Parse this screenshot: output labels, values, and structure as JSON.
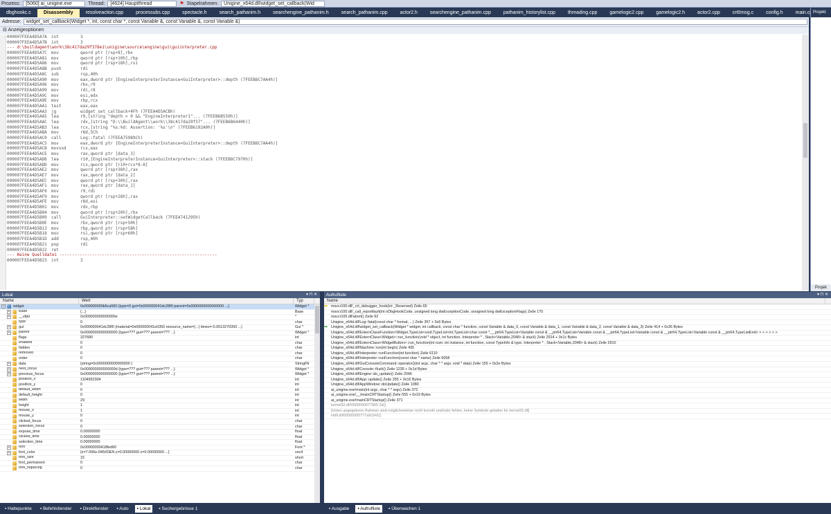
{
  "debug_toolbar": {
    "process_label": "Prozess:",
    "process_value": "[5060] ai_unigine.exe",
    "thread_label": "Thread:",
    "thread_value": "[4624] Hauptthread",
    "stack_label": "Stapelrahmen:",
    "stack_value": "Unigine_x64d.dll!widget_set_callback(Wid"
  },
  "doc_tabs": [
    {
      "label": "dbghookc.c",
      "active": false
    },
    {
      "label": "Disassembly",
      "active": true
    },
    {
      "label": "resolveaction.cpp",
      "active": false
    },
    {
      "label": "processubs.cpp",
      "active": false
    },
    {
      "label": "spectacle.h",
      "active": false
    },
    {
      "label": "search_pathanim.h",
      "active": false
    },
    {
      "label": "searchengine_pathanim.h",
      "active": false
    },
    {
      "label": "search_pathanim.cpp",
      "active": false
    },
    {
      "label": "actor2.h",
      "active": false
    },
    {
      "label": "searchengine_pathanim.cpp",
      "active": false
    },
    {
      "label": "pathanim_historylist.cpp",
      "active": false
    },
    {
      "label": "threading.cpp",
      "active": false
    },
    {
      "label": "gamelogic2.cpp",
      "active": false
    },
    {
      "label": "gamelogic2.h",
      "active": false
    },
    {
      "label": "actor2.cpp",
      "active": false
    },
    {
      "label": "crt0msg.c",
      "active": false
    },
    {
      "label": "config.h",
      "active": false
    },
    {
      "label": "main.cpp",
      "active": false
    }
  ],
  "disassembly": {
    "address_label": "Adresse:",
    "address_value": "widget_set_callback(Widget *, int, const char *, const Variable &, const Variable &, const Variable &)",
    "view_options": "Anzeigeoptionen",
    "lines": [
      {
        "addr": "000007FEEA4D5A7A",
        "mn": "int",
        "op": "3",
        "kind": "code"
      },
      {
        "addr": "000007FEEA4D5A7B",
        "mn": "int",
        "op": "3",
        "kind": "code"
      },
      {
        "text": "--- d:\\buildagent\\work\\38c417da29f378e1\\unigine\\source\\engine\\gui\\guiinterpreter.cpp",
        "kind": "sep"
      },
      {
        "addr": "000007FEEA4D5A7C",
        "mn": "mov",
        "op": "qword ptr [rsp+8],rbx",
        "kind": "code"
      },
      {
        "addr": "000007FEEA4D5A81",
        "mn": "mov",
        "op": "qword ptr [rsp+10h],rbp",
        "kind": "code"
      },
      {
        "addr": "000007FEEA4D5A86",
        "mn": "mov",
        "op": "qword ptr [rsp+18h],rsi",
        "kind": "code"
      },
      {
        "addr": "000007FEEA4D5A8B",
        "mn": "push",
        "op": "rdi",
        "kind": "code"
      },
      {
        "addr": "000007FEEA4D5A8C",
        "mn": "sub",
        "op": "rsp,40h",
        "kind": "code"
      },
      {
        "addr": "000007FEEA4D5A90",
        "mn": "mov",
        "op": "eax,dword ptr [EngineInterpreterInstance<GuiInterpreter>::depth (7FEEB8C7AA4h)]",
        "kind": "code"
      },
      {
        "addr": "000007FEEA4D5A96",
        "mn": "mov",
        "op": "rbx,r9",
        "kind": "code"
      },
      {
        "addr": "000007FEEA4D5A99",
        "mn": "mov",
        "op": "rdi,r8",
        "kind": "code"
      },
      {
        "addr": "000007FEEA4D5A9C",
        "mn": "mov",
        "op": "esi,edx",
        "kind": "code"
      },
      {
        "addr": "000007FEEA4D5A9E",
        "mn": "mov",
        "op": "rbp,rcx",
        "kind": "code"
      },
      {
        "addr": "000007FEEA4D5AA1",
        "mn": "test",
        "op": "eax,eax",
        "kind": "code"
      },
      {
        "addr": "000007FEEA4D5AA3",
        "mn": "jg",
        "op": "widget_set_callback+4Fh (7FEEA4D5ACBh)",
        "kind": "code"
      },
      {
        "addr": "000007FEEA4D5AA5",
        "mn": "lea",
        "op": "r9,[string \"depth > 0 && \"EngineInterpreter1\"... (7FEEB6B550h)]",
        "kind": "code"
      },
      {
        "addr": "000007FEEA4D5AAC",
        "mn": "lea",
        "op": "rdx,[string \"D:\\\\BuildAgent\\\\work\\\\38c417da29f37\"... (7FEEB6B6440h)]",
        "kind": "code"
      },
      {
        "addr": "000007FEEA4D5AB3",
        "mn": "lea",
        "op": "rcx,[string \"%s:%d: Assertion: '%s'\\n\" (7FEEB6192A0h)]",
        "kind": "code"
      },
      {
        "addr": "000007FEEA4D5ABA",
        "mn": "mov",
        "op": "r8d,5Ch",
        "kind": "code"
      },
      {
        "addr": "000007FEEA4D5AC0",
        "mn": "call",
        "op": "Log::fatal (7FEEA75989Ch)",
        "kind": "code"
      },
      {
        "addr": "000007FEEA4D5AC5",
        "mn": "mov",
        "op": "eax,dword ptr [EngineInterpreterInstance<GuiInterpreter>::depth (7FEEB8C7AA4h)]",
        "kind": "cur"
      },
      {
        "addr": "000007FEEA4D5ACB",
        "mn": "movsxd",
        "op": "rcx,eax",
        "kind": "code"
      },
      {
        "addr": "000007FEEA4D5ACE",
        "mn": "mov",
        "op": "rax,qword ptr [data_3]",
        "kind": "code"
      },
      {
        "addr": "000007FEEA4D5AD6",
        "mn": "lea",
        "op": "r10,[EngineInterpreterInstance<GuiInterpreter>::stack (7FEEB8C7970h)]",
        "kind": "code"
      },
      {
        "addr": "000007FEEA4D5ADD",
        "mn": "mov",
        "op": "rcx,qword ptr [r10+rcx*8-8]",
        "kind": "code"
      },
      {
        "addr": "000007FEEA4D5AE2",
        "mn": "mov",
        "op": "qword ptr [rsp+38h],rax",
        "kind": "code"
      },
      {
        "addr": "000007FEEA4D5AE7",
        "mn": "mov",
        "op": "rax,qword ptr [data_2]",
        "kind": "code"
      },
      {
        "addr": "000007FEEA4D5AEC",
        "mn": "mov",
        "op": "qword ptr [rsp+30h],rax",
        "kind": "code"
      },
      {
        "addr": "000007FEEA4D5AF1",
        "mn": "mov",
        "op": "rax,qword ptr [data_1]",
        "kind": "code"
      },
      {
        "addr": "000007FEEA4D5AF6",
        "mn": "mov",
        "op": "r9,rdi",
        "kind": "code"
      },
      {
        "addr": "000007FEEA4D5AF9",
        "mn": "mov",
        "op": "qword ptr [rsp+28h],rax",
        "kind": "code"
      },
      {
        "addr": "000007FEEA4D5AFE",
        "mn": "mov",
        "op": "r8d,esi",
        "kind": "code"
      },
      {
        "addr": "000007FEEA4D5B01",
        "mn": "mov",
        "op": "rdx,rbp",
        "kind": "code"
      },
      {
        "addr": "000007FEEA4D5B04",
        "mn": "mov",
        "op": "qword ptr [rsp+20h],rbx",
        "kind": "code"
      },
      {
        "addr": "000007FEEA4D5B09",
        "mn": "call",
        "op": "GuiInterpreter::setWidgetCallback (7FEEA741295h)",
        "kind": "code"
      },
      {
        "addr": "000007FEEA4D5B0E",
        "mn": "mov",
        "op": "rbx,qword ptr [rsp+50h]",
        "kind": "code"
      },
      {
        "addr": "000007FEEA4D5B13",
        "mn": "mov",
        "op": "rbp,qword ptr [rsp+58h]",
        "kind": "code"
      },
      {
        "addr": "000007FEEA4D5B18",
        "mn": "mov",
        "op": "rsi,qword ptr [rsp+60h]",
        "kind": "code"
      },
      {
        "addr": "000007FEEA4D5B1D",
        "mn": "add",
        "op": "rsp,40h",
        "kind": "code"
      },
      {
        "addr": "000007FEEA4D5B21",
        "mn": "pop",
        "op": "rdi",
        "kind": "code"
      },
      {
        "addr": "000007FEEA4D5B22",
        "mn": "ret",
        "op": "",
        "kind": "code"
      },
      {
        "text": "--- Keine Quelldatei ---------------------------------------------------------------",
        "kind": "sep"
      },
      {
        "addr": "000007FEEA4D5B23",
        "mn": "int",
        "op": "3",
        "kind": "code"
      }
    ]
  },
  "solution_explorer": {
    "title": "Projekt",
    "bottom": "Projek"
  },
  "locals": {
    "title": "Lokal",
    "columns": [
      "Name",
      "Wert",
      "Typ"
    ],
    "rows": [
      {
        "name": "widget",
        "value": "0x000000000b6ca560 {type=0 gui=0x000000041dc28f0 parent=0x0000000000000000 ...}",
        "type": "Widget *",
        "exp": "-",
        "indent": 0,
        "sel": true
      },
      {
        "name": "Base",
        "value": "{...}",
        "type": "Base",
        "exp": "+",
        "indent": 1
      },
      {
        "name": "__vfptr",
        "value": "0x000000000000000e",
        "type": "*",
        "exp": "+",
        "indent": 1
      },
      {
        "name": "type",
        "value": "0",
        "type": "char",
        "exp": "",
        "indent": 1
      },
      {
        "name": "gui",
        "value": "0x000000041dc28f0 {material=0x000000041e0350 resource_name={...} times=-0.0013270393 ...}",
        "type": "Gui *",
        "exp": "+",
        "indent": 1
      },
      {
        "name": "parent",
        "value": "0x0000000000000000 {type=??? gui=??? parent=??? ...}",
        "type": "Widget *",
        "exp": "+",
        "indent": 1
      },
      {
        "name": "flags",
        "value": "327680",
        "type": "int",
        "exp": "",
        "indent": 1
      },
      {
        "name": "enabled",
        "value": "0",
        "type": "char",
        "exp": "",
        "indent": 1
      },
      {
        "name": "hidden",
        "value": "0",
        "type": "char",
        "exp": "",
        "indent": 1
      },
      {
        "name": "removed",
        "value": "0",
        "type": "char",
        "exp": "",
        "indent": 1
      },
      {
        "name": "order",
        "value": "0",
        "type": "char",
        "exp": "",
        "indent": 1
      },
      {
        "name": "data",
        "value": "{string=0x0000000000000000 }",
        "type": "StringPtr",
        "exp": "+",
        "indent": 1
      },
      {
        "name": "next_focus",
        "value": "0x000000000000000d {type=??? gui=??? parent=??? ...}",
        "type": "Widget *",
        "exp": "+",
        "indent": 1
      },
      {
        "name": "previous_focus",
        "value": "0x0000000000000000 {type=??? gui=??? parent=??? ...}",
        "type": "Widget *",
        "exp": "+",
        "indent": 1
      },
      {
        "name": "position_x",
        "value": "1104952304",
        "type": "int",
        "exp": "",
        "indent": 1
      },
      {
        "name": "position_y",
        "value": "0",
        "type": "int",
        "exp": "",
        "indent": 1
      },
      {
        "name": "default_width",
        "value": "0",
        "type": "int",
        "exp": "",
        "indent": 1
      },
      {
        "name": "default_height",
        "value": "0",
        "type": "int",
        "exp": "",
        "indent": 1
      },
      {
        "name": "width",
        "value": "29",
        "type": "int",
        "exp": "",
        "indent": 1
      },
      {
        "name": "height",
        "value": "1",
        "type": "int",
        "exp": "",
        "indent": 1
      },
      {
        "name": "mouse_x",
        "value": "1",
        "type": "int",
        "exp": "",
        "indent": 1
      },
      {
        "name": "mouse_y",
        "value": "0",
        "type": "int",
        "exp": "",
        "indent": 1
      },
      {
        "name": "clicked_focus",
        "value": "0",
        "type": "char",
        "exp": "",
        "indent": 1
      },
      {
        "name": "selection_focus",
        "value": "0",
        "type": "char",
        "exp": "",
        "indent": 1
      },
      {
        "name": "expose_time",
        "value": "0.00000000",
        "type": "float",
        "exp": "",
        "indent": 1
      },
      {
        "name": "clicked_time",
        "value": "0.00000000",
        "type": "float",
        "exp": "",
        "indent": 1
      },
      {
        "name": "selection_time",
        "value": "0.00000000",
        "type": "float",
        "exp": "",
        "indent": 1
      },
      {
        "name": "font",
        "value": "0x00000000418fed60",
        "type": "Font *",
        "exp": "+",
        "indent": 1
      },
      {
        "name": "font_color",
        "value": "{x=7.006e-045#DEN y=0.00000000 z=0.00000000 ...}",
        "type": "vec4",
        "exp": "+",
        "indent": 1
      },
      {
        "name": "font_size",
        "value": "15",
        "type": "short",
        "exp": "",
        "indent": 1
      },
      {
        "name": "font_permanent",
        "value": "0",
        "type": "char",
        "exp": "",
        "indent": 1
      },
      {
        "name": "font_hspacing",
        "value": "0",
        "type": "char",
        "exp": "",
        "indent": 1
      }
    ]
  },
  "callstack": {
    "title": "Aufrufliste",
    "columns": [
      "Name"
    ],
    "rows": [
      {
        "text": "msvcr100.dll!_crt_debugger_hook(int _Reserved)  Zeile 65",
        "mark": "arrow",
        "style": ""
      },
      {
        "text": "msvcr100.dll!_call_reportfault(int nDbgHookCode, unsigned long dwExceptionCode, unsigned long dwExceptionFlags)  Zeile 170",
        "mark": "",
        "style": ""
      },
      {
        "text": "msvcr100.dll!abort()  Zeile 92",
        "mark": "",
        "style": ""
      },
      {
        "text": "Unigine_x64d.dll!Log::fatal(const char * format, ...)  Zeile 357 + 0x6 Bytes",
        "mark": "",
        "style": ""
      },
      {
        "text": "Unigine_x64d.dll!widget_set_callback(Widget * widget, int callback, const char * function, const Variable & data_0, const Variable & data_1, const Variable & data_2, const Variable & data_3)  Zeile 414 + 0x35 Bytes",
        "mark": "green",
        "style": ""
      },
      {
        "text": "Unigine_x64d.dll!ExternClassFunction<Widget,TypeList<void,TypeList<int,TypeList<char const *,__ptr64,TypeList<Variable const & __ptr64,TypeList<Variable const & __ptr64,TypeList<Variable const & __ptr64,TypeList<Variable const & __ptr64,TypeListEnd> > > > > > >",
        "mark": "",
        "style": ""
      },
      {
        "text": "Unigine_x64d.dll!ExternClass<Widget>::run_function(void * object, int function, Interpreter * , Stack<Variable,2048> & stack)  Zeile 2914 + 0x1c Bytes",
        "mark": "",
        "style": ""
      },
      {
        "text": "Unigine_x64d.dll!ExternClass<WidgetButton>::run_function(int num, int instance, int function, const TypeInfo & type, Interpreter * , Stack<Variable,2048> & stack)  Zeile 2910",
        "mark": "",
        "style": ""
      },
      {
        "text": "Unigine_x64d.dll!Machine::run(int begin)  Zeile 435",
        "mark": "",
        "style": ""
      },
      {
        "text": "Unigine_x64d.dll!Interpreter::runFunction(int function)  Zeile 6110",
        "mark": "",
        "style": ""
      },
      {
        "text": "Unigine_x64d.dll!Interpreter::runFunction(const char * name)  Zeile 6058",
        "mark": "",
        "style": ""
      },
      {
        "text": "Unigine_x64d.dll!GuiConsoleCommand::operator()(int argc, char * * argv, void * data)  Zeile 155 + 0x2e Bytes",
        "mark": "",
        "style": ""
      },
      {
        "text": "Unigine_x64d.dll!Console::flush()  Zeile 1235 + 0x1d Bytes",
        "mark": "",
        "style": ""
      },
      {
        "text": "Unigine_x64d.dll!Engine::do_update()  Zeile 2046",
        "mark": "",
        "style": ""
      },
      {
        "text": "Unigine_x64d.dll!App::update()  Zeile 255 + 0x16 Bytes",
        "mark": "",
        "style": ""
      },
      {
        "text": "Unigine_x64d.dll!AppWindow::doUpdate()  Zeile 1080",
        "mark": "",
        "style": ""
      },
      {
        "text": "ai_unigine.exe!main(int argc, char * * argv)  Zeile 372",
        "mark": "",
        "style": ""
      },
      {
        "text": "ai_unigine.exe!__tmainCRTStartup()  Zeile 555 + 0x19 Bytes",
        "mark": "",
        "style": ""
      },
      {
        "text": "ai_unigine.exe!mainCRTStartup()  Zeile 371",
        "mark": "",
        "style": ""
      },
      {
        "text": "kernel32.dll!0000000077965 2d()",
        "mark": "",
        "style": "gray"
      },
      {
        "text": "[Unten angegebene Rahmen sind möglicherweise nicht korrekt und/oder fehlen, keine Symbole geladen für kernel32.dll]",
        "mark": "",
        "style": "gray"
      },
      {
        "text": "ntdll.dll!00000000777a9c541()",
        "mark": "",
        "style": "gray"
      }
    ]
  },
  "bottom_left_tabs": [
    "Haltepunkte",
    "Befehlsfenster",
    "Direktfenster",
    "Auto",
    "Lokal",
    "Suchergebnisse 1"
  ],
  "bottom_left_active": "Lokal",
  "bottom_right_tabs": [
    "Ausgabe",
    "Aufrufliste",
    "Überwachen 1"
  ],
  "bottom_right_active": "Aufrufliste"
}
